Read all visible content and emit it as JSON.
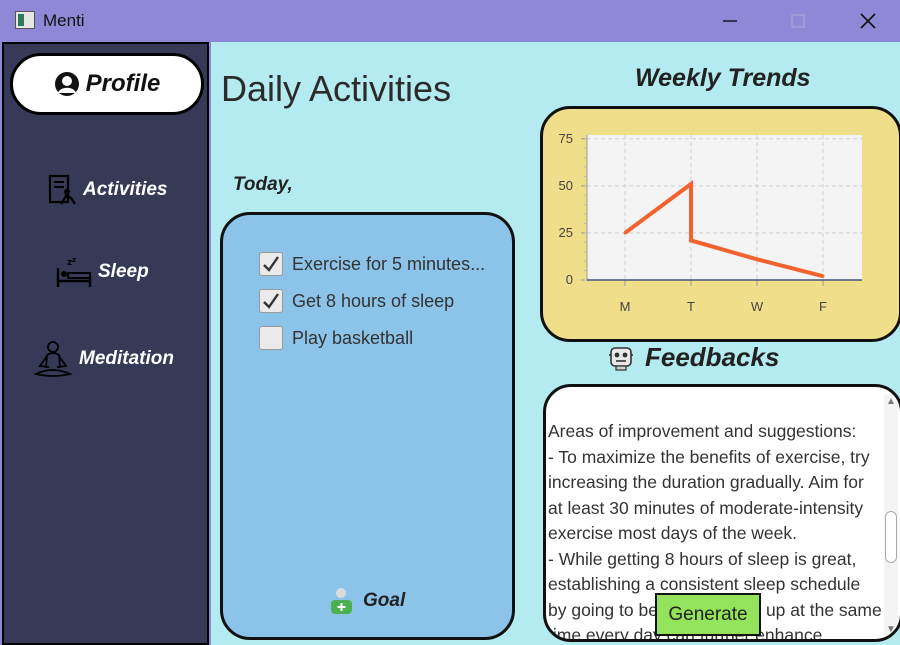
{
  "window": {
    "title": "Menti"
  },
  "sidebar": {
    "profile": {
      "label": "Profile",
      "icon": "profile-icon"
    },
    "items": [
      {
        "label": "Activities",
        "icon": "activities-icon"
      },
      {
        "label": "Sleep",
        "icon": "sleep-icon"
      },
      {
        "label": "Meditation",
        "icon": "meditation-icon"
      }
    ]
  },
  "main": {
    "title": "Daily Activities",
    "today_label": "Today,",
    "tasks": [
      {
        "text": "Exercise for 5 minutes...",
        "checked": true
      },
      {
        "text": "Get 8 hours of sleep",
        "checked": true
      },
      {
        "text": "Play basketball",
        "checked": false
      }
    ],
    "goal_label": "Goal"
  },
  "trends": {
    "title": "Weekly Trends"
  },
  "chart_data": {
    "type": "line",
    "categories": [
      "M",
      "T",
      "W",
      "F"
    ],
    "x": [
      "M",
      "T",
      "T",
      "W",
      "F"
    ],
    "series": [
      {
        "values": [
          25,
          51,
          21,
          11,
          2
        ]
      }
    ],
    "y_ticks": [
      0,
      25,
      50,
      75
    ],
    "ylim": [
      0,
      77
    ],
    "grid": true,
    "line_color": "#f2622c",
    "plot_background": "#f4f4f4"
  },
  "feedback": {
    "title": "Feedbacks",
    "text": "Areas of improvement and suggestions:\n- To maximize the benefits of exercise, try increasing the duration gradually. Aim for at least 30 minutes of moderate-intensity exercise most days of the week.\n- While getting 8 hours of sleep is great, establishing a consistent sleep schedule by going to bed and waking up at the same time every day can further enhance",
    "generate_label": "Generate"
  },
  "colors": {
    "titlebar": "#8d89d6",
    "sidebar": "#373a56",
    "main_bg": "#b3ebf1",
    "tasks_panel": "#8cc3e9",
    "chart_panel": "#f0de8a",
    "generate": "#94e35c"
  }
}
